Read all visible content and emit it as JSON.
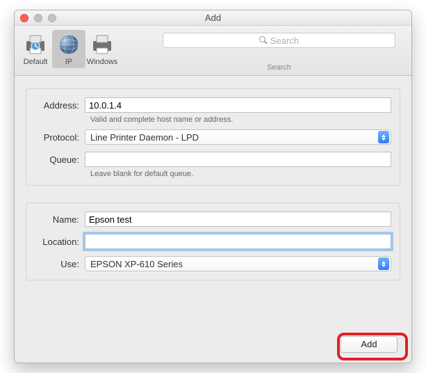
{
  "window": {
    "title": "Add"
  },
  "toolbar": {
    "items": [
      {
        "label": "Default",
        "icon": "printer-default-icon"
      },
      {
        "label": "IP",
        "icon": "globe-icon"
      },
      {
        "label": "Windows",
        "icon": "printer-icon"
      }
    ],
    "selected_index": 1
  },
  "search": {
    "placeholder": "Search",
    "label": "Search"
  },
  "form_top": {
    "address": {
      "label": "Address:",
      "value": "10.0.1.4",
      "helper": "Valid and complete host name or address."
    },
    "protocol": {
      "label": "Protocol:",
      "value": "Line Printer Daemon - LPD"
    },
    "queue": {
      "label": "Queue:",
      "value": "",
      "helper": "Leave blank for default queue."
    }
  },
  "form_bottom": {
    "name": {
      "label": "Name:",
      "value": "Epson test"
    },
    "location": {
      "label": "Location:",
      "value": ""
    },
    "use": {
      "label": "Use:",
      "value": "EPSON XP-610 Series"
    }
  },
  "footer": {
    "add_label": "Add"
  }
}
